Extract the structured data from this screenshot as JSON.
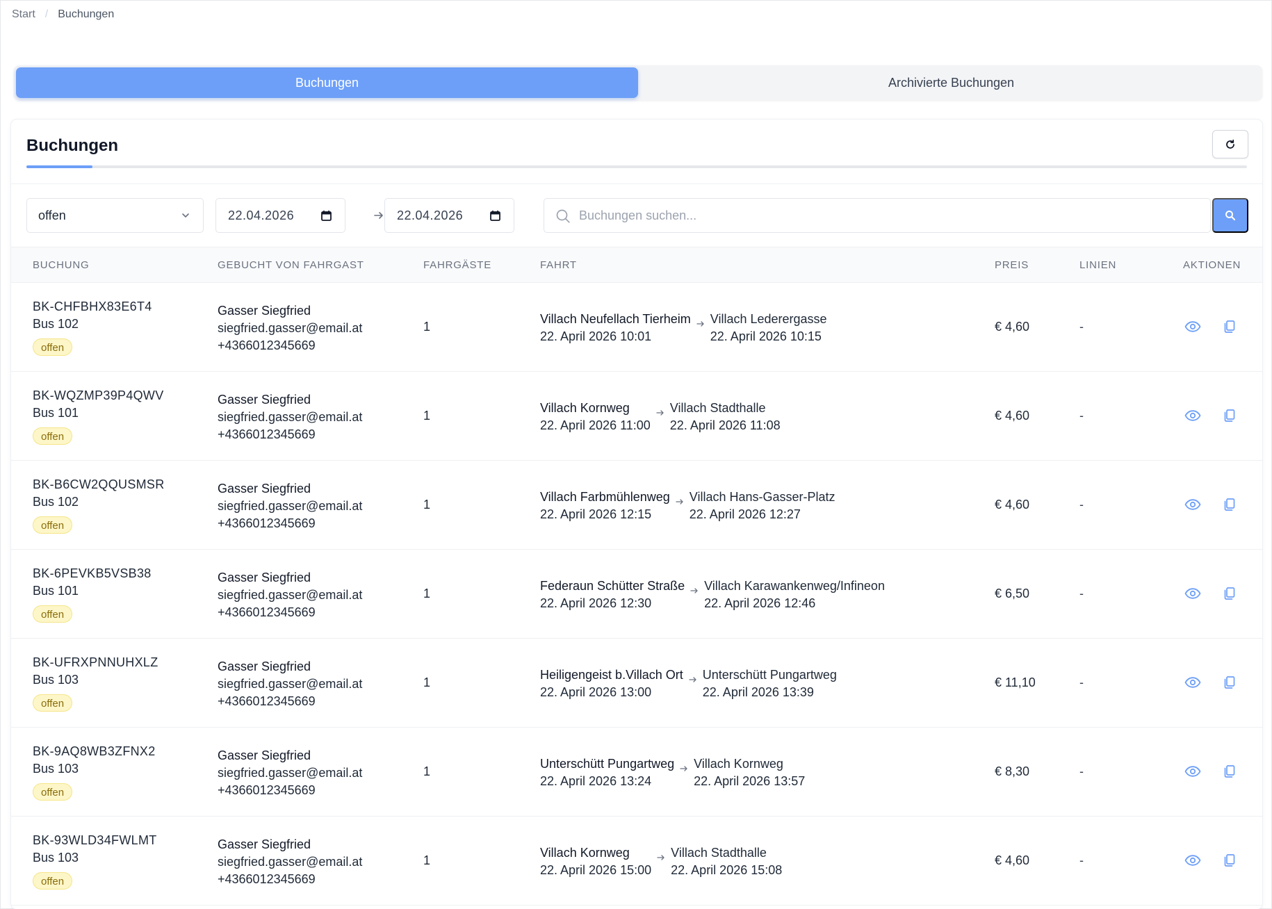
{
  "breadcrumb": {
    "home": "Start",
    "separator": "/",
    "current": "Buchungen"
  },
  "tabs": [
    {
      "label": "Buchungen",
      "active": true
    },
    {
      "label": "Archivierte Buchungen",
      "active": false
    }
  ],
  "card": {
    "title": "Buchungen",
    "progress_fraction": 0.054
  },
  "filters": {
    "status_value": "offen",
    "date_from": "22.04.2026",
    "date_to": "22.04.2026",
    "search_placeholder": "Buchungen suchen..."
  },
  "table": {
    "headers": {
      "booking": "BUCHUNG",
      "guest": "GEBUCHT VON FAHRGAST",
      "pax": "FAHRGÄSTE",
      "trip": "FAHRT",
      "price": "PREIS",
      "lines": "LINIEN",
      "actions": "AKTIONEN"
    },
    "rows": [
      {
        "code": "BK-CHFBHX83E6T4",
        "bus": "Bus 102",
        "status": "offen",
        "guest_name": "Gasser Siegfried",
        "guest_email": "siegfried.gasser@email.at",
        "guest_phone": "+4366012345669",
        "pax": "1",
        "from_stop": "Villach Neufellach Tierheim",
        "from_time": "22. April 2026 10:01",
        "to_stop": "Villach Lederergasse",
        "to_time": "22. April 2026 10:15",
        "price": "€ 4,60",
        "lines": "-"
      },
      {
        "code": "BK-WQZMP39P4QWV",
        "bus": "Bus 101",
        "status": "offen",
        "guest_name": "Gasser Siegfried",
        "guest_email": "siegfried.gasser@email.at",
        "guest_phone": "+4366012345669",
        "pax": "1",
        "from_stop": "Villach Kornweg",
        "from_time": "22. April 2026 11:00",
        "to_stop": "Villach Stadthalle",
        "to_time": "22. April 2026 11:08",
        "price": "€ 4,60",
        "lines": "-"
      },
      {
        "code": "BK-B6CW2QQUSMSR",
        "bus": "Bus 102",
        "status": "offen",
        "guest_name": "Gasser Siegfried",
        "guest_email": "siegfried.gasser@email.at",
        "guest_phone": "+4366012345669",
        "pax": "1",
        "from_stop": "Villach Farbmühlenweg",
        "from_time": "22. April 2026 12:15",
        "to_stop": "Villach Hans-Gasser-Platz",
        "to_time": "22. April 2026 12:27",
        "price": "€ 4,60",
        "lines": "-"
      },
      {
        "code": "BK-6PEVKB5VSB38",
        "bus": "Bus 101",
        "status": "offen",
        "guest_name": "Gasser Siegfried",
        "guest_email": "siegfried.gasser@email.at",
        "guest_phone": "+4366012345669",
        "pax": "1",
        "from_stop": "Federaun Schütter Straße",
        "from_time": "22. April 2026 12:30",
        "to_stop": "Villach Karawankenweg/Infineon",
        "to_time": "22. April 2026 12:46",
        "price": "€ 6,50",
        "lines": "-"
      },
      {
        "code": "BK-UFRXPNNUHXLZ",
        "bus": "Bus 103",
        "status": "offen",
        "guest_name": "Gasser Siegfried",
        "guest_email": "siegfried.gasser@email.at",
        "guest_phone": "+4366012345669",
        "pax": "1",
        "from_stop": "Heiligengeist b.Villach Ort",
        "from_time": "22. April 2026 13:00",
        "to_stop": "Unterschütt Pungartweg",
        "to_time": "22. April 2026 13:39",
        "price": "€ 11,10",
        "lines": "-"
      },
      {
        "code": "BK-9AQ8WB3ZFNX2",
        "bus": "Bus 103",
        "status": "offen",
        "guest_name": "Gasser Siegfried",
        "guest_email": "siegfried.gasser@email.at",
        "guest_phone": "+4366012345669",
        "pax": "1",
        "from_stop": "Unterschütt Pungartweg",
        "from_time": "22. April 2026 13:24",
        "to_stop": "Villach Kornweg",
        "to_time": "22. April 2026 13:57",
        "price": "€ 8,30",
        "lines": "-"
      },
      {
        "code": "BK-93WLD34FWLMT",
        "bus": "Bus 103",
        "status": "offen",
        "guest_name": "Gasser Siegfried",
        "guest_email": "siegfried.gasser@email.at",
        "guest_phone": "+4366012345669",
        "pax": "1",
        "from_stop": "Villach Kornweg",
        "from_time": "22. April 2026 15:00",
        "to_stop": "Villach Stadthalle",
        "to_time": "22. April 2026 15:08",
        "price": "€ 4,60",
        "lines": "-"
      }
    ]
  },
  "icons": {
    "refresh": "refresh-icon",
    "chevron": "chevron-down-icon",
    "calendar": "calendar-icon",
    "arrow": "arrow-right-icon",
    "search": "search-icon",
    "view": "eye-icon",
    "copy": "copy-icon"
  },
  "colors": {
    "accent": "#6d9ff8",
    "badge_bg": "#fdf6c8",
    "badge_text": "#8a6d0b"
  }
}
